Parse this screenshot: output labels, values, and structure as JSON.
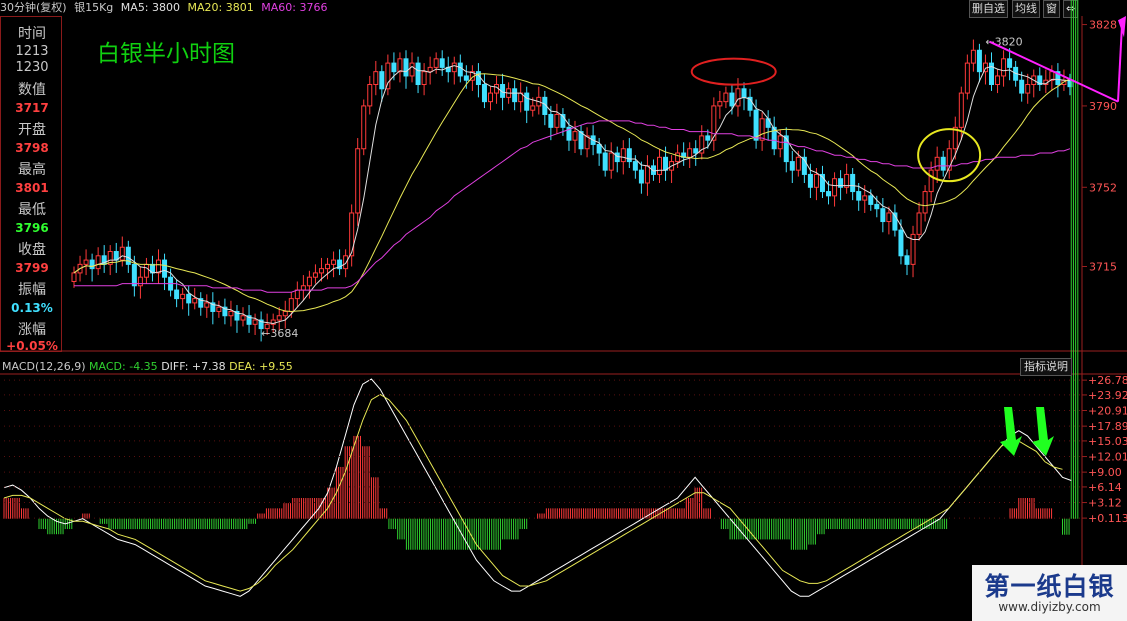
{
  "header": {
    "period": "30分钟(复权)",
    "symbol": "银15Kg",
    "ma5": "MA5: 3800",
    "ma20": "MA20: 3801",
    "ma60": "MA60: 3766",
    "buttons": [
      "删自选",
      "均线",
      "窗",
      "⇔"
    ]
  },
  "info_panel": {
    "time_label": "时间",
    "time_value1": "1213",
    "time_value2": "1230",
    "value_label": "数值",
    "value": "3717",
    "open_label": "开盘",
    "open": "3798",
    "high_label": "最高",
    "high": "3801",
    "low_label": "最低",
    "low": "3796",
    "close_label": "收盘",
    "close": "3799",
    "amplitude_label": "振幅",
    "amplitude": "0.13%",
    "change_label": "涨幅",
    "change": "+0.05%"
  },
  "chart_title": "白银半小时图",
  "macd": {
    "label": "MACD(12,26,9)",
    "macd": "MACD: -4.35",
    "diff": "DIFF: +7.38",
    "dea": "DEA: +9.55",
    "indicator_button": "指标说明"
  },
  "watermark": {
    "title": "第一纸白银",
    "url": "www.diyizby.com"
  },
  "colors": {
    "up": "#ff3a3a",
    "down": "#40e0ff",
    "ma5": "#e0e0e0",
    "ma20": "#e8e855",
    "ma60": "#e040e0",
    "axis": "#9a1f1f"
  },
  "chart_data": [
    {
      "type": "candlestick",
      "title": "白银半小时图",
      "y_ticks": [
        3828,
        3790,
        3752,
        3715
      ],
      "ylim": [
        3676,
        3832
      ],
      "annotations": [
        "3820",
        "3684"
      ],
      "series_ma": [
        "MA5",
        "MA20",
        "MA60"
      ],
      "close": [
        3712,
        3716,
        3718,
        3714,
        3720,
        3716,
        3722,
        3718,
        3724,
        3716,
        3706,
        3710,
        3716,
        3712,
        3718,
        3710,
        3704,
        3700,
        3702,
        3698,
        3700,
        3696,
        3698,
        3694,
        3696,
        3692,
        3694,
        3690,
        3692,
        3688,
        3690,
        3686,
        3688,
        3690,
        3692,
        3694,
        3700,
        3704,
        3706,
        3710,
        3712,
        3714,
        3716,
        3718,
        3714,
        3720,
        3740,
        3770,
        3790,
        3800,
        3806,
        3798,
        3810,
        3806,
        3812,
        3804,
        3810,
        3800,
        3806,
        3808,
        3812,
        3808,
        3806,
        3810,
        3804,
        3802,
        3806,
        3800,
        3792,
        3796,
        3800,
        3794,
        3798,
        3792,
        3796,
        3788,
        3790,
        3794,
        3786,
        3780,
        3786,
        3780,
        3774,
        3778,
        3770,
        3776,
        3772,
        3768,
        3760,
        3768,
        3764,
        3770,
        3764,
        3760,
        3754,
        3762,
        3758,
        3766,
        3760,
        3764,
        3768,
        3766,
        3770,
        3768,
        3776,
        3774,
        3790,
        3792,
        3796,
        3790,
        3798,
        3794,
        3788,
        3774,
        3784,
        3780,
        3770,
        3776,
        3764,
        3760,
        3766,
        3758,
        3752,
        3758,
        3750,
        3748,
        3756,
        3752,
        3758,
        3750,
        3746,
        3748,
        3744,
        3742,
        3736,
        3740,
        3732,
        3720,
        3716,
        3730,
        3740,
        3750,
        3760,
        3766,
        3760,
        3770,
        3780,
        3796,
        3810,
        3816,
        3806,
        3810,
        3800,
        3804,
        3812,
        3808,
        3802,
        3796,
        3800,
        3804,
        3800,
        3802,
        3806,
        3800,
        3802,
        3799
      ],
      "ma60": [
        3706,
        3706,
        3706,
        3706,
        3706,
        3706,
        3706,
        3706,
        3707,
        3707,
        3707,
        3707,
        3707,
        3707,
        3707,
        3707,
        3707,
        3707,
        3706,
        3706,
        3706,
        3706,
        3706,
        3705,
        3705,
        3705,
        3705,
        3705,
        3704,
        3704,
        3704,
        3704,
        3703,
        3703,
        3703,
        3703,
        3703,
        3704,
        3704,
        3704,
        3704,
        3704,
        3705,
        3705,
        3705,
        3705,
        3706,
        3708,
        3711,
        3714,
        3717,
        3719,
        3722,
        3725,
        3727,
        3730,
        3732,
        3734,
        3736,
        3738,
        3741,
        3743,
        3745,
        3748,
        3750,
        3752,
        3754,
        3756,
        3758,
        3760,
        3762,
        3764,
        3766,
        3768,
        3770,
        3771,
        3773,
        3774,
        3775,
        3776,
        3777,
        3778,
        3779,
        3780,
        3781,
        3782,
        3782,
        3783,
        3783,
        3783,
        3783,
        3783,
        3783,
        3782,
        3782,
        3781,
        3781,
        3780,
        3780,
        3779,
        3779,
        3779,
        3778,
        3778,
        3778,
        3778,
        3777,
        3777,
        3777,
        3777,
        3776,
        3776,
        3776,
        3775,
        3775,
        3774,
        3774,
        3773,
        3773,
        3772,
        3771,
        3771,
        3770,
        3769,
        3769,
        3768,
        3767,
        3767,
        3766,
        3766,
        3765,
        3765,
        3764,
        3764,
        3763,
        3763,
        3762,
        3762,
        3762,
        3761,
        3761,
        3761,
        3761,
        3762,
        3762,
        3762,
        3762,
        3763,
        3763,
        3764,
        3764,
        3765,
        3765,
        3766,
        3766,
        3766,
        3766,
        3767,
        3767,
        3767,
        3768,
        3768,
        3768,
        3769,
        3769,
        3770
      ]
    },
    {
      "type": "bar+line",
      "title": "MACD(12,26,9)",
      "y_ticks": [
        26.78,
        23.92,
        20.91,
        17.89,
        15.03,
        12.01,
        9.0,
        6.14,
        3.12,
        0.113
      ],
      "ylim": [
        -19,
        27
      ],
      "series": [
        {
          "name": "DIFF",
          "values": [
            6,
            6.5,
            5.5,
            4,
            2,
            0.5,
            -0.5,
            -1,
            -0.5,
            0,
            -1,
            -2,
            -3,
            -4,
            -4.5,
            -5,
            -6,
            -7,
            -8,
            -9,
            -10,
            -11,
            -12,
            -13,
            -13.5,
            -14,
            -14.5,
            -15,
            -14,
            -12,
            -10,
            -8,
            -6,
            -4,
            -2,
            0,
            2,
            5,
            10,
            16,
            22,
            26,
            27,
            25,
            22,
            19,
            16,
            13,
            10,
            7,
            4,
            1,
            -2,
            -5,
            -8,
            -10,
            -12,
            -13,
            -14,
            -14,
            -13,
            -12,
            -11,
            -10,
            -9,
            -8,
            -7,
            -6,
            -5,
            -4,
            -3,
            -2,
            -1,
            0,
            1,
            2,
            3,
            4,
            6,
            8,
            6,
            4,
            2,
            0,
            -2,
            -4,
            -6,
            -8,
            -10,
            -12,
            -14,
            -15,
            -15,
            -14,
            -13,
            -12,
            -11,
            -10,
            -9,
            -8,
            -7,
            -6,
            -5,
            -4,
            -3,
            -2,
            -1,
            0,
            2,
            4,
            6,
            8,
            10,
            12,
            14,
            16,
            17,
            16,
            14,
            12,
            10,
            8,
            7.38
          ]
        },
        {
          "name": "DEA",
          "values": [
            4,
            4.5,
            4.5,
            4,
            3,
            2,
            1,
            0,
            -0.5,
            -0.5,
            -1,
            -1.5,
            -2,
            -3,
            -3.5,
            -4,
            -5,
            -6,
            -7,
            -8,
            -9,
            -10,
            -11,
            -12,
            -12.5,
            -13,
            -13.5,
            -14,
            -13.5,
            -12.5,
            -11,
            -9,
            -7.5,
            -6,
            -4,
            -2,
            0,
            2,
            5,
            9,
            14,
            19,
            23,
            24,
            23,
            21,
            19,
            16,
            13,
            10,
            7,
            4,
            1,
            -2,
            -5,
            -7,
            -9,
            -11,
            -12,
            -13,
            -13,
            -12.5,
            -12,
            -11,
            -10,
            -9,
            -8,
            -7,
            -6,
            -5,
            -4,
            -3,
            -2,
            -1,
            0,
            1,
            2,
            3,
            4,
            5,
            5,
            4,
            3,
            2,
            0,
            -2,
            -4,
            -6,
            -8,
            -10,
            -11,
            -12,
            -12.5,
            -12.5,
            -12,
            -11,
            -10,
            -9,
            -8,
            -7,
            -6,
            -5,
            -4,
            -3,
            -2,
            -1,
            0,
            1,
            2,
            4,
            6,
            8,
            10,
            12,
            14,
            15,
            15,
            14,
            13,
            11,
            10,
            9.55
          ]
        }
      ],
      "annotations": [
        "▼ 下跌箭头",
        "▼ 下跌箭头"
      ]
    }
  ]
}
